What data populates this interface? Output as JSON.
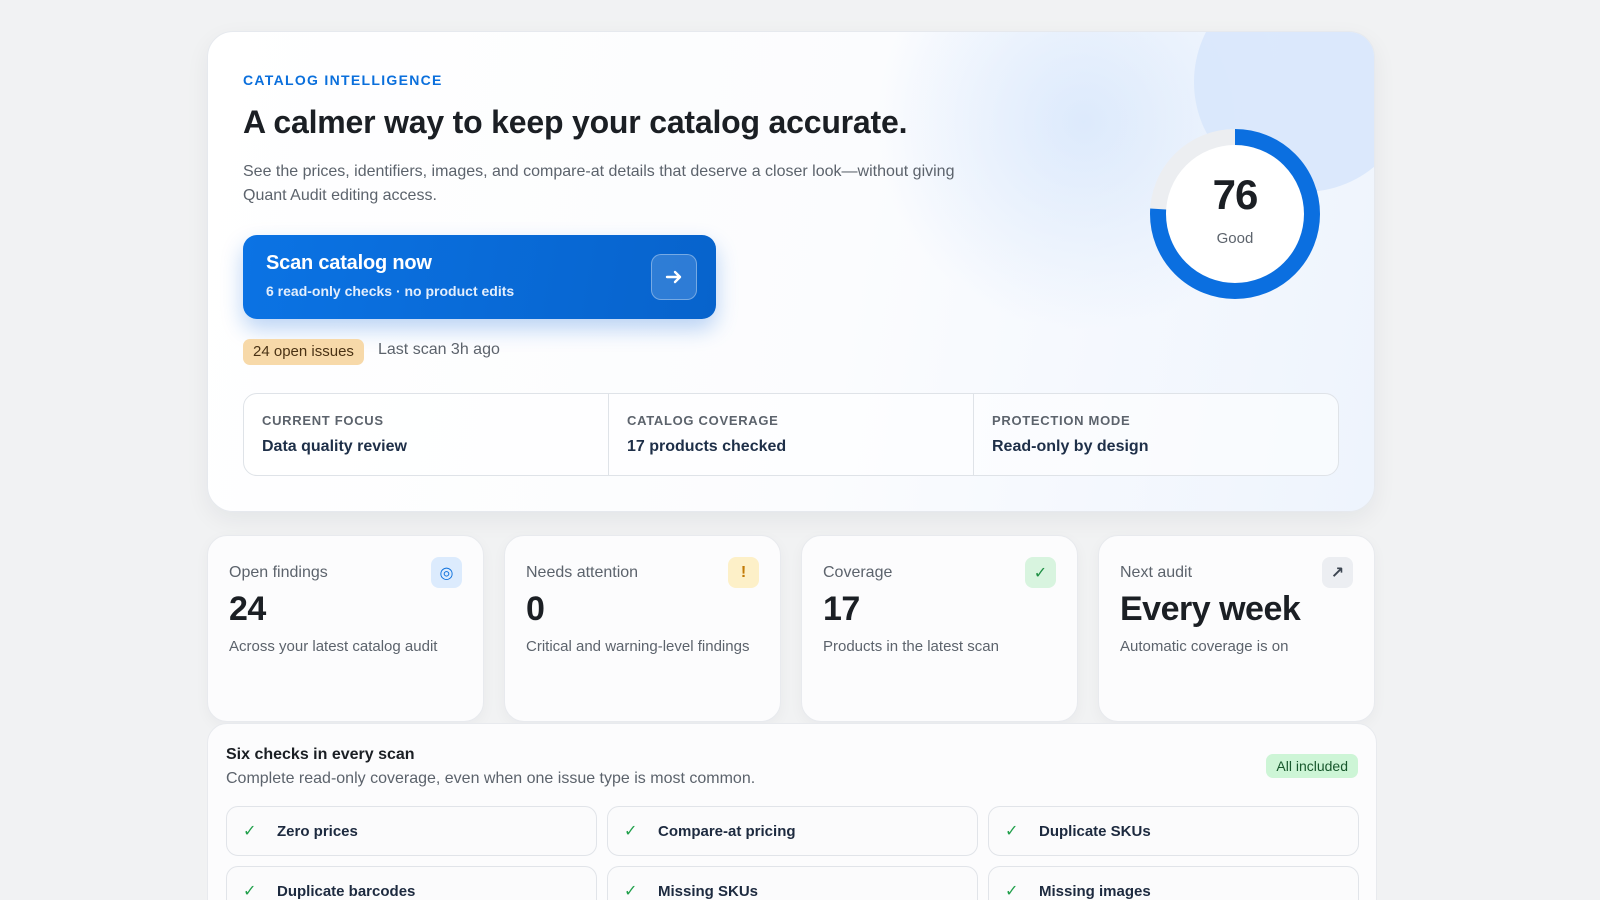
{
  "hero": {
    "eyebrow": "CATALOG INTELLIGENCE",
    "headline": "A calmer way to keep your catalog accurate.",
    "subtext": "See the prices, identifiers, images, and compare-at details that deserve a closer look—without giving Quant Audit editing access.",
    "cta": {
      "title": "Scan catalog now",
      "subtitle": "6 read-only checks · no product edits",
      "icon": "arrow-right-icon"
    },
    "issues_badge": "24 open issues",
    "last_scan": "Last scan 3h ago",
    "facts": [
      {
        "label": "CURRENT FOCUS",
        "value": "Data quality review"
      },
      {
        "label": "CATALOG COVERAGE",
        "value": "17 products checked"
      },
      {
        "label": "PROTECTION MODE",
        "value": "Read-only by design"
      }
    ],
    "score": {
      "value": "76",
      "label": "Good",
      "fraction": 0.76
    }
  },
  "stats": [
    {
      "label": "Open findings",
      "value": "24",
      "desc": "Across your latest catalog audit",
      "icon": "target-icon",
      "icon_bg": "#dcebfd",
      "icon_color": "#0a6fdc",
      "glyph": "◎"
    },
    {
      "label": "Needs attention",
      "value": "0",
      "desc": "Critical and warning-level findings",
      "icon": "alert-icon",
      "icon_bg": "#fdf0c8",
      "icon_color": "#c27a06",
      "glyph": "!"
    },
    {
      "label": "Coverage",
      "value": "17",
      "desc": "Products in the latest scan",
      "icon": "check-icon",
      "icon_bg": "#d8f4df",
      "icon_color": "#1f8f44",
      "glyph": "✓"
    },
    {
      "label": "Next audit",
      "value": "Every week",
      "desc": "Automatic coverage is on",
      "icon": "arrow-up-right-icon",
      "icon_bg": "#eceef2",
      "icon_color": "#3d4652",
      "glyph": "↗"
    }
  ],
  "checks": {
    "title": "Six checks in every scan",
    "subtitle": "Complete read-only coverage, even when one issue type is most common.",
    "badge": "All included",
    "items": [
      "Zero prices",
      "Compare-at pricing",
      "Duplicate SKUs",
      "Duplicate barcodes",
      "Missing SKUs",
      "Missing images"
    ]
  },
  "colors": {
    "accent": "#0a6fdc",
    "warning_badge": "#f7d9a9",
    "success_badge": "#cdf5d6"
  }
}
